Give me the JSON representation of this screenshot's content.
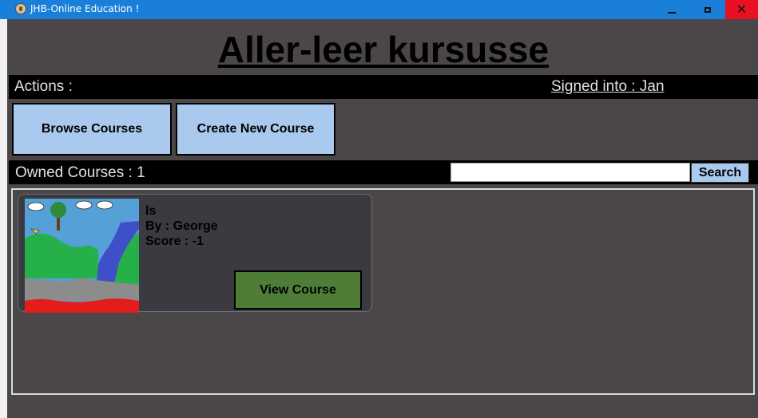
{
  "window": {
    "title": "JHB-Online Education !",
    "controls": {
      "minimize_icon": "minimize-icon",
      "maximize_icon": "maximize-icon",
      "close_glyph": "✕"
    }
  },
  "header": {
    "title": "Aller-leer kursusse"
  },
  "actions_bar": {
    "label": "Actions :",
    "signed_in": "Signed into : Jan"
  },
  "buttons": {
    "browse": "Browse Courses",
    "create": "Create New Course"
  },
  "owned": {
    "label": "Owned Courses : 1",
    "search": {
      "value": "",
      "placeholder": "",
      "button": "Search"
    }
  },
  "courses": [
    {
      "title": "ls",
      "author": "By : George",
      "score": "Score : -1",
      "view_label": "View Course",
      "thumbnail_icon": "landscape-drawing"
    }
  ],
  "colors": {
    "titlebar": "#1a7fd8",
    "background": "#4b4748",
    "button_blue": "#a9c9ee",
    "view_green": "#4f7d38",
    "close_red": "#e81123"
  }
}
